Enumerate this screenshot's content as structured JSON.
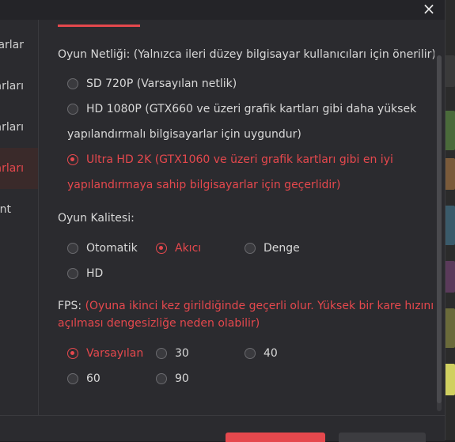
{
  "dialog": {
    "close_icon": "×"
  },
  "sidebar": {
    "items": [
      {
        "label": "arlar"
      },
      {
        "label": "arları"
      },
      {
        "label": "arları"
      },
      {
        "label": "arları",
        "active": true
      },
      {
        "label": "nt"
      }
    ]
  },
  "clarity": {
    "title": "Oyun Netliği: (Yalnızca ileri düzey bilgisayar kullanıcıları için önerilir)",
    "options": [
      {
        "label": "SD 720P (Varsayılan netlik)",
        "checked": false
      },
      {
        "label": "HD 1080P (GTX660 ve üzeri grafik kartları gibi daha yüksek",
        "line2": "yapılandırmalı bilgisayarlar için uygundur)",
        "checked": false
      },
      {
        "label": "Ultra HD 2K (GTX1060 ve üzeri grafik kartları gibi en iyi",
        "line2": "yapılandırmaya sahip bilgisayarlar için geçerlidir)",
        "checked": true
      }
    ]
  },
  "quality": {
    "title": "Oyun Kalitesi:",
    "options": [
      {
        "label": "Otomatik",
        "checked": false
      },
      {
        "label": "Akıcı",
        "checked": true
      },
      {
        "label": "Denge",
        "checked": false
      },
      {
        "label": "HD",
        "checked": false
      }
    ]
  },
  "fps": {
    "title": "FPS:",
    "note_line1": "(Oyuna ikinci kez girildiğinde geçerli olur. Yüksek bir kare hızının",
    "note_line2": "açılması dengesizliğe neden olabilir)",
    "options": [
      {
        "label": "Varsayılan",
        "checked": true
      },
      {
        "label": "30",
        "checked": false
      },
      {
        "label": "40",
        "checked": false
      },
      {
        "label": "60",
        "checked": false
      },
      {
        "label": "90",
        "checked": false
      }
    ]
  },
  "colors": {
    "accent": "#e5484d",
    "background": "#2b2b2f",
    "text": "#d8d8d8"
  }
}
